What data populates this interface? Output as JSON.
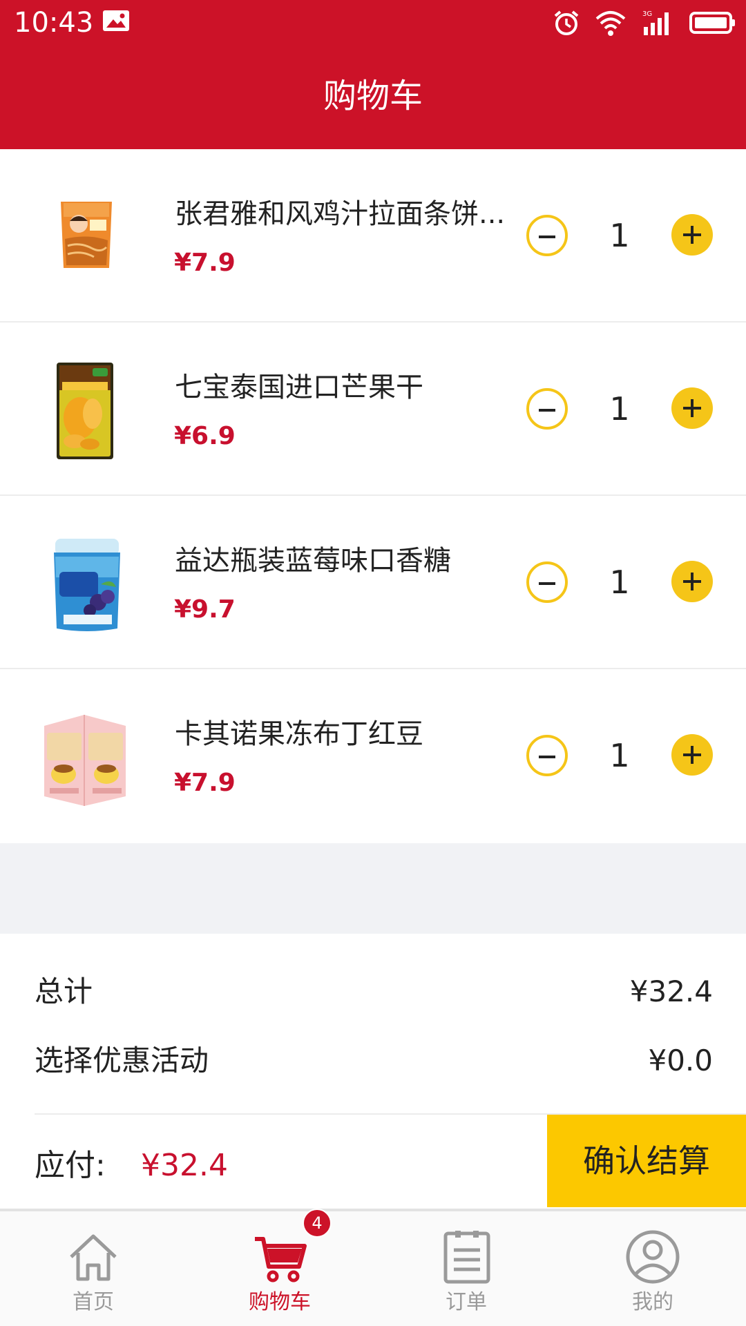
{
  "status_bar": {
    "time": "10:43"
  },
  "header": {
    "title": "购物车"
  },
  "cart": {
    "items": [
      {
        "name": "张君雅和风鸡汁拉面条饼...",
        "price": "¥7.9",
        "quantity": "1"
      },
      {
        "name": "七宝泰国进口芒果干",
        "price": "¥6.9",
        "quantity": "1"
      },
      {
        "name": "益达瓶装蓝莓味口香糖",
        "price": "¥9.7",
        "quantity": "1"
      },
      {
        "name": "卡其诺果冻布丁红豆",
        "price": "¥7.9",
        "quantity": "1"
      }
    ]
  },
  "summary": {
    "total_label": "总计",
    "total_value": "¥32.4",
    "promo_label": "选择优惠活动",
    "promo_value": "¥0.0",
    "payable_label": "应付:",
    "payable_value": "¥32.4",
    "checkout_label": "确认结算"
  },
  "tabbar": {
    "tabs": [
      {
        "label": "首页",
        "icon": "home-icon"
      },
      {
        "label": "购物车",
        "icon": "cart-icon",
        "badge": "4"
      },
      {
        "label": "订单",
        "icon": "order-icon"
      },
      {
        "label": "我的",
        "icon": "user-icon"
      }
    ],
    "active_tab": "购物车"
  },
  "colors": {
    "brand_red": "#cc1228",
    "accent_yellow": "#fcc800",
    "price_red": "#c8102e"
  }
}
